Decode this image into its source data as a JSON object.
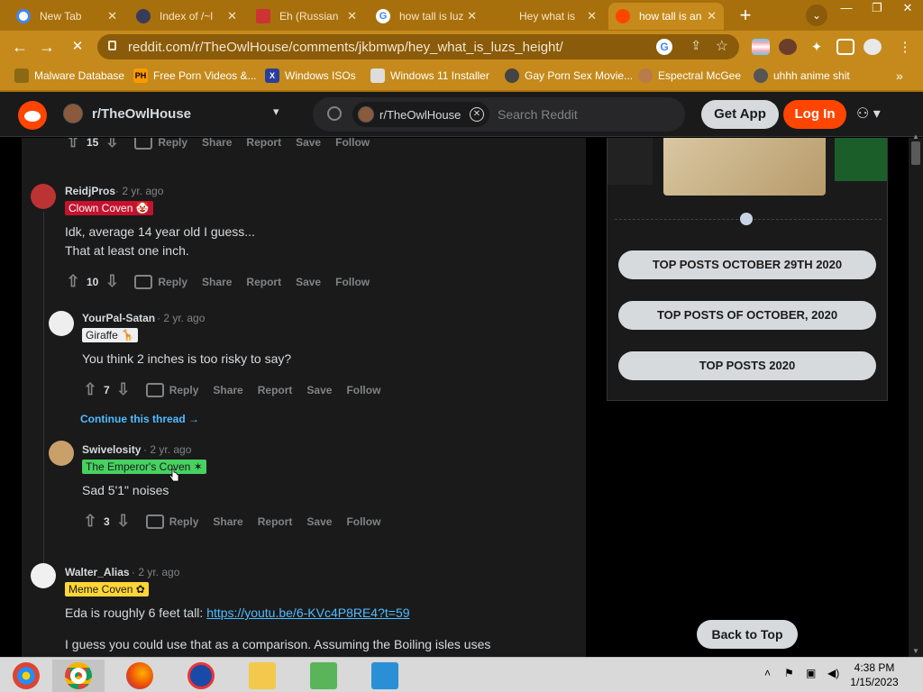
{
  "browser": {
    "tabs": [
      {
        "label": "New Tab",
        "active": false
      },
      {
        "label": "Index of /~l",
        "active": false
      },
      {
        "label": "Eh (Russian",
        "active": false
      },
      {
        "label": "how tall is luz",
        "active": false
      },
      {
        "label": "Hey what is",
        "active": false
      },
      {
        "label": "how tall is an",
        "active": true
      }
    ],
    "url": "reddit.com/r/TheOwlHouse/comments/jkbmwp/hey_what_is_luzs_height/",
    "bookmarks": [
      "Malware Database",
      "Free Porn Videos &...",
      "Windows ISOs",
      "Windows 11 Installer",
      "Gay Porn Sex Movie...",
      "Espectral McGee",
      "uhhh anime shit"
    ],
    "bookmark_more": "»"
  },
  "reddit": {
    "subreddit": "r/TheOwlHouse",
    "search_chip": "r/TheOwlHouse",
    "search_placeholder": "Search Reddit",
    "get_app": "Get App",
    "log_in": "Log In",
    "back_to_top": "Back to Top",
    "top_partial": {
      "score": "15",
      "actions": [
        "Reply",
        "Share",
        "Report",
        "Save",
        "Follow"
      ]
    },
    "comments": [
      {
        "author": "ReidjPros",
        "age": "· 2 yr. ago",
        "flair": "Clown Coven",
        "body": [
          "Idk, average 14 year old I guess...",
          "That at least one inch."
        ],
        "score": "10",
        "actions": [
          "Reply",
          "Share",
          "Report",
          "Save",
          "Follow"
        ]
      },
      {
        "author": "YourPal-Satan",
        "age": "· 2 yr. ago",
        "flair": "Giraffe",
        "body": [
          "You think 2 inches is too risky to say?"
        ],
        "score": "7",
        "actions": [
          "Reply",
          "Share",
          "Report",
          "Save",
          "Follow"
        ]
      },
      {
        "author": "Swivelosity",
        "age": "· 2 yr. ago",
        "flair": "The Emperor's Coven",
        "body": [
          "Sad 5'1\" noises"
        ],
        "score": "3",
        "actions": [
          "Reply",
          "Share",
          "Report",
          "Save",
          "Follow"
        ]
      },
      {
        "author": "Walter_Alias",
        "age": "· 2 yr. ago",
        "flair": "Meme Coven",
        "body_prefix": "Eda is roughly 6 feet tall: ",
        "body_link": "https://youtu.be/6-KVc4P8RE4?t=59",
        "body2": "I guess you could use that as a comparison. Assuming the Boiling isles uses"
      }
    ],
    "continue_thread": "Continue this thread →",
    "sidebar_buttons": [
      "TOP POSTS OCTOBER 29TH 2020",
      "TOP POSTS OF OCTOBER, 2020",
      "TOP POSTS 2020"
    ]
  },
  "taskbar": {
    "time": "4:38 PM",
    "date": "1/15/2023"
  },
  "colors": {
    "chrome": "#c58a1b",
    "reddit_orange": "#ff4500",
    "link": "#4fbcff",
    "clown_flair": "#c4122f",
    "meme_flair": "#ffd635"
  }
}
